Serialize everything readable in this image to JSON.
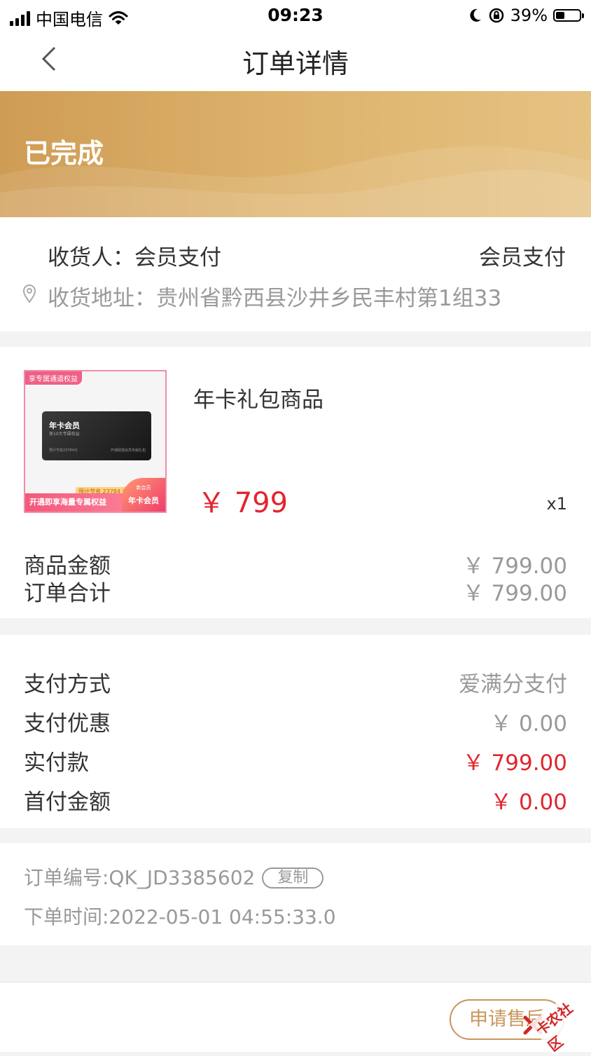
{
  "status_bar": {
    "carrier": "中国电信",
    "time": "09:23",
    "battery": "39%",
    "battery_level": 0.39
  },
  "nav": {
    "title": "订单详情",
    "back_icon": "chevron-left-icon"
  },
  "order_status": "已完成",
  "address": {
    "recipient": "收货人：会员支付",
    "phone": "会员支付",
    "full": "收货地址：贵州省黔西县沙井乡民丰村第1组33"
  },
  "product": {
    "name": "年卡礼包商品",
    "price": "￥ 799",
    "qty": "x1",
    "thumb": {
      "tag": "享专属通道权益",
      "card_title": "年卡会员",
      "card_sub": "享10大专属权益",
      "card_note": "预计节省23784元",
      "card_note2": "开通即送会员专属礼包",
      "save_tag": "预计节省 23784 元",
      "bottom_text": "开通即享海量专属权益",
      "badge_top": "新会员",
      "badge": "年卡会员"
    }
  },
  "summary": {
    "goods_label": "商品金额",
    "goods_value": "￥ 799.00",
    "total_label": "订单合计",
    "total_value": "￥ 799.00"
  },
  "payment": {
    "method_label": "支付方式",
    "method_value": "爱满分支付",
    "discount_label": "支付优惠",
    "discount_value": "￥ 0.00",
    "paid_label": "实付款",
    "paid_value": "￥ 799.00",
    "down_label": "首付金额",
    "down_value": "￥ 0.00"
  },
  "info": {
    "order_no": "订单编号:QK_JD3385602",
    "copy": "复制",
    "order_time": "下单时间:2022-05-01 04:55:33.0"
  },
  "footer": {
    "after_sale": "申请售后"
  },
  "watermark": "卡农社区",
  "colors": {
    "accent": "#e2262f",
    "gold": "#c9965b",
    "banner_start": "#cf9c55",
    "banner_end": "#e6c283"
  }
}
